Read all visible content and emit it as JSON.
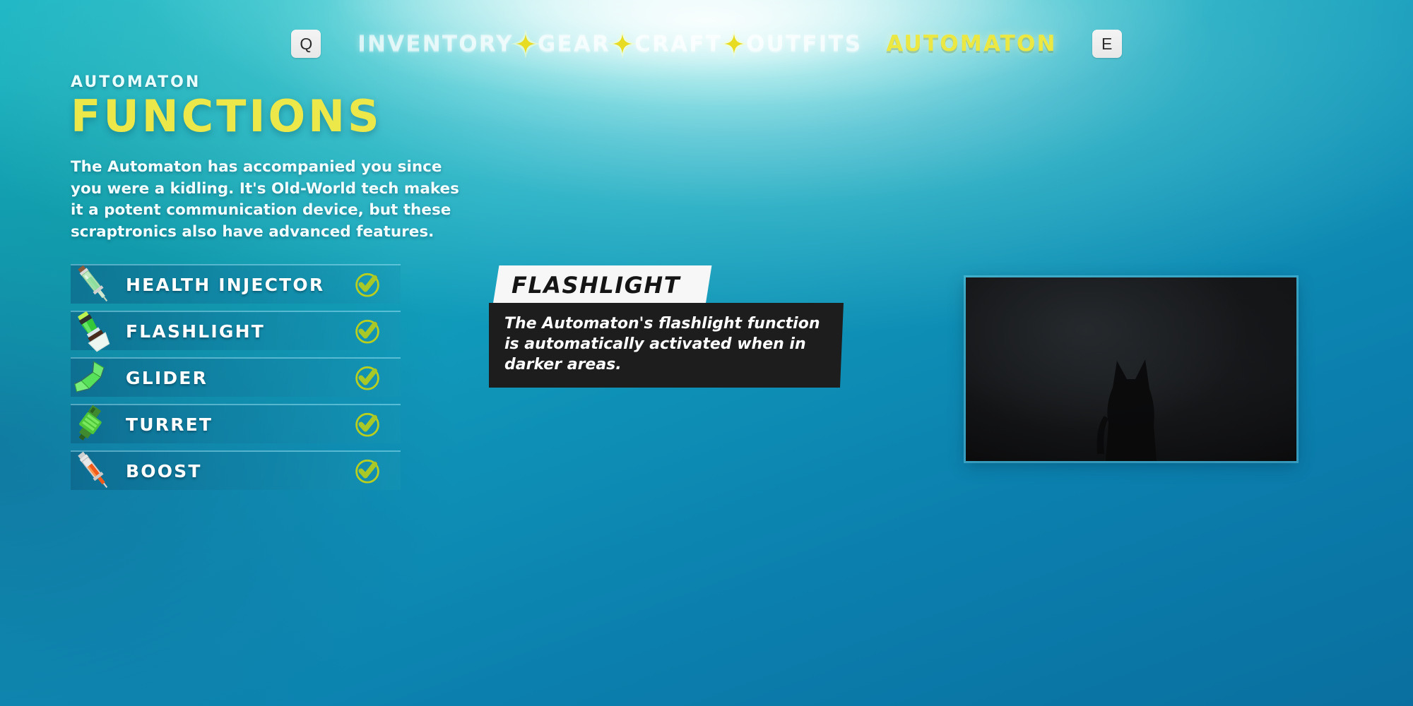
{
  "nav": {
    "prev_key": "Q",
    "next_key": "E",
    "tabs": [
      {
        "label": "INVENTORY",
        "active": false
      },
      {
        "label": "GEAR",
        "active": false
      },
      {
        "label": "CRAFT",
        "active": false
      },
      {
        "label": "OUTFITS",
        "active": false
      },
      {
        "label": "AUTOMATON",
        "active": true
      }
    ],
    "separator_icon": "sparkle-diamond-icon"
  },
  "header": {
    "kicker": "AUTOMATON",
    "title": "FUNCTIONS",
    "description": "The Automaton has accompanied you since you were a kidling. It's Old-World tech makes it a potent communication device, but these scraptronics also have advanced features."
  },
  "functions": {
    "items": [
      {
        "label": "HEALTH INJECTOR",
        "icon": "syringe-icon",
        "unlocked": true,
        "selected": false
      },
      {
        "label": "FLASHLIGHT",
        "icon": "flashlight-icon",
        "unlocked": true,
        "selected": true
      },
      {
        "label": "GLIDER",
        "icon": "glider-wings-icon",
        "unlocked": true,
        "selected": false
      },
      {
        "label": "TURRET",
        "icon": "turret-icon",
        "unlocked": true,
        "selected": false
      },
      {
        "label": "BOOST",
        "icon": "boost-syringe-icon",
        "unlocked": true,
        "selected": false
      }
    ],
    "status_icon": "check-circle-icon"
  },
  "tooltip": {
    "title": "FLASHLIGHT",
    "body": "The Automaton's flashlight function is automatically activated when in darker areas."
  },
  "preview": {
    "alt": "dark-scene-preview"
  },
  "colors": {
    "accent_yellow": "#ece84a",
    "check_green": "#a8c827",
    "check_ring": "#b9cf1f",
    "background_teal": "#0f93b7",
    "tooltip_dark": "#1d1d1d",
    "row_fill": "#0c6084"
  }
}
